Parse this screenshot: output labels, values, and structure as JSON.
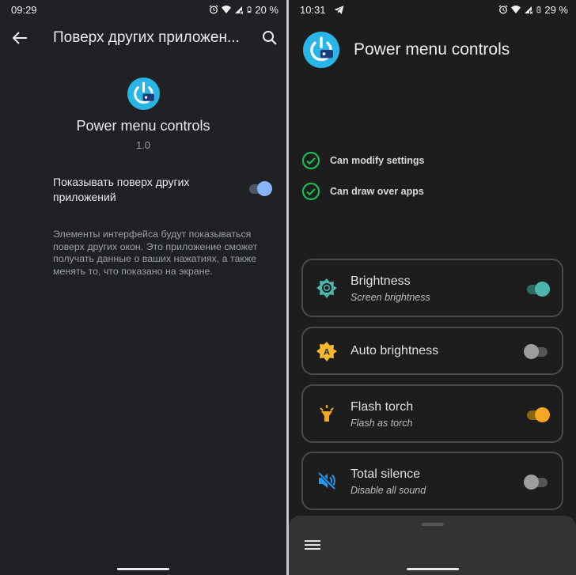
{
  "left_screen": {
    "status_bar": {
      "time": "09:29",
      "icons": [
        "alarm-icon",
        "wifi-icon",
        "cell-signal-icon",
        "battery-icon"
      ],
      "battery": "20 %"
    },
    "toolbar": {
      "back_icon": "arrow-left-icon",
      "title": "Поверх других приложен...",
      "search_icon": "search-icon"
    },
    "app": {
      "icon": "power-menu-app-icon",
      "name": "Power menu controls",
      "version": "1.0"
    },
    "setting": {
      "label": "Показывать поверх других приложений",
      "enabled": true
    },
    "description": "Элементы интерфейса будут показываться поверх других окон. Это приложение сможет получать данные о ваших нажатиях, а также менять то, что показано на экране."
  },
  "right_screen": {
    "status_bar": {
      "time": "10:31",
      "notification_icon": "telegram-icon",
      "icons": [
        "alarm-icon",
        "wifi-icon",
        "cell-signal-icon",
        "battery-charging-icon"
      ],
      "battery": "29 %"
    },
    "header": {
      "icon": "power-menu-app-icon",
      "title": "Power menu controls"
    },
    "permissions": [
      {
        "label": "Can modify settings",
        "granted": true
      },
      {
        "label": "Can draw over apps",
        "granted": true
      }
    ],
    "controls": [
      {
        "title": "Brightness",
        "subtitle": "Screen brightness",
        "icon": "brightness-icon",
        "enabled": true,
        "accent": "#4db6ac"
      },
      {
        "title": "Auto brightness",
        "subtitle": "",
        "icon": "auto-brightness-icon",
        "enabled": false,
        "accent": "#f5b82e"
      },
      {
        "title": "Flash torch",
        "subtitle": "Flash as torch",
        "icon": "flashlight-icon",
        "enabled": true,
        "accent": "#f5a623"
      },
      {
        "title": "Total silence",
        "subtitle": "Disable all sound",
        "icon": "volume-off-icon",
        "enabled": false,
        "accent": "#2196f3"
      }
    ],
    "bottom_sheet": {
      "menu_icon": "hamburger-menu-icon"
    }
  },
  "colors": {
    "left_bg": "#202124",
    "right_bg": "#1d1d1d",
    "left_switch_on": "#8ab4f8",
    "check_green": "#1db954",
    "app_icon_blue": "#29b6e6"
  }
}
